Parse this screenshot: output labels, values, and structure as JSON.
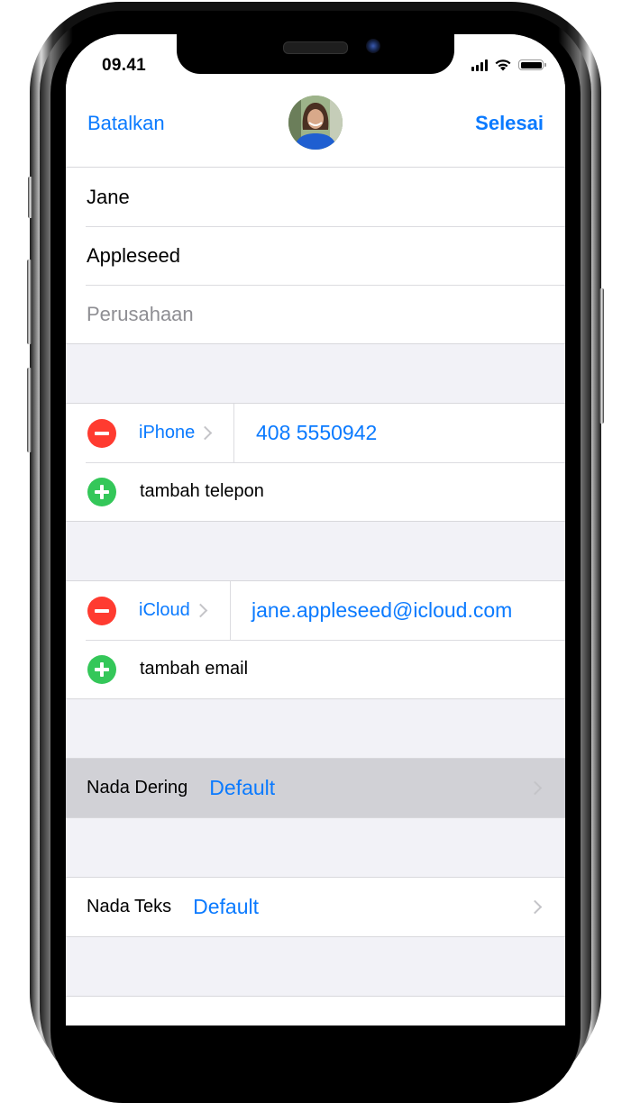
{
  "status_bar": {
    "time": "09.41",
    "icons": [
      "cellular-signal-icon",
      "wifi-icon",
      "battery-icon"
    ]
  },
  "navbar": {
    "cancel_label": "Batalkan",
    "done_label": "Selesai",
    "avatar": "contact-photo"
  },
  "name_fields": {
    "first_name": "Jane",
    "last_name": "Appleseed",
    "company_placeholder": "Perusahaan"
  },
  "phone": {
    "type_label": "iPhone",
    "number": "408 5550942",
    "add_label": "tambah telepon"
  },
  "email": {
    "type_label": "iCloud",
    "address": "jane.appleseed@icloud.com",
    "add_label": "tambah email"
  },
  "ringtone": {
    "label": "Nada Dering",
    "value": "Default",
    "selected": true
  },
  "text_tone": {
    "label": "Nada Teks",
    "value": "Default"
  },
  "colors": {
    "accent": "#0a7aff",
    "delete": "#ff3b30",
    "add": "#34c759",
    "grouped_background": "#f2f2f7",
    "selected_row": "#d1d1d6"
  }
}
